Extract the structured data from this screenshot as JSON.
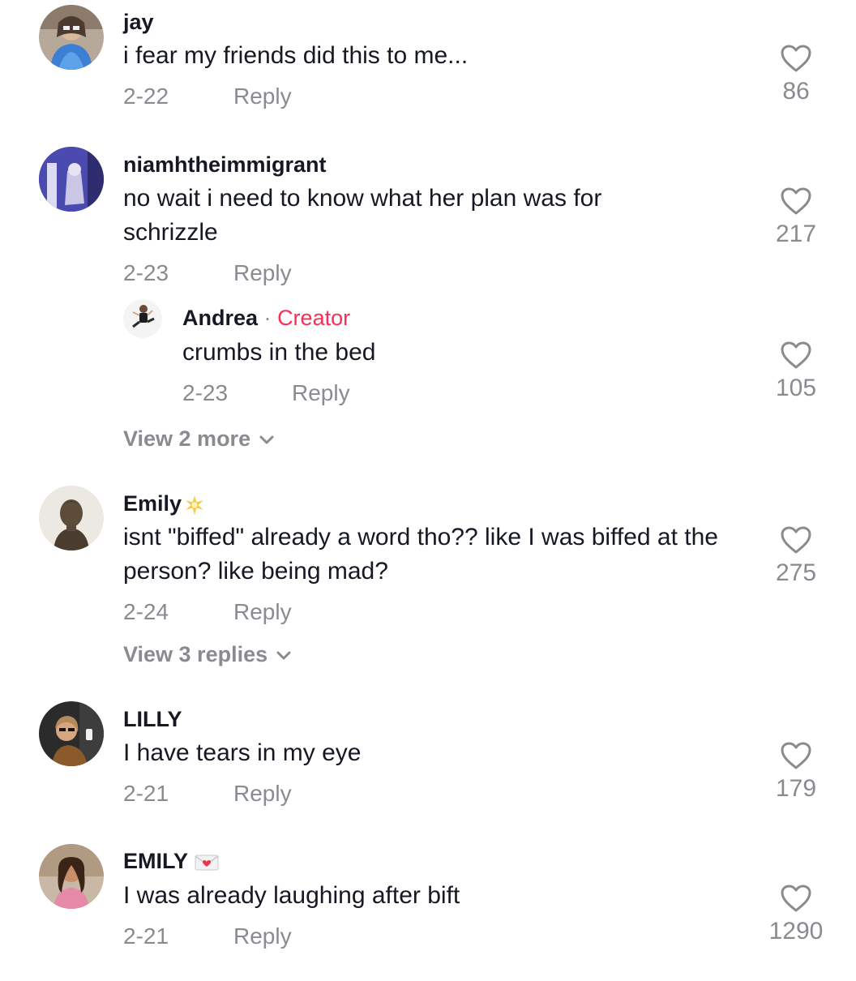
{
  "comments": [
    {
      "username": "jay",
      "text": "i fear my friends did this to me...",
      "date": "2-22",
      "reply": "Reply",
      "likes": "86"
    },
    {
      "username": "niamhtheimmigrant",
      "text": "no wait i need to know what her plan was for schrizzle",
      "date": "2-23",
      "reply": "Reply",
      "likes": "217",
      "replies": [
        {
          "username": "Andrea",
          "separator": "·",
          "badge": "Creator",
          "text": "crumbs in the bed",
          "date": "2-23",
          "reply": "Reply",
          "likes": "105"
        }
      ],
      "view_more": "View 2 more"
    },
    {
      "username": "Emily",
      "username_emoji": "sparkle-star",
      "text": "isnt \"biffed\" already a word tho?? like I was biffed at the person? like being mad?",
      "date": "2-24",
      "reply": "Reply",
      "likes": "275",
      "view_more": "View 3 replies"
    },
    {
      "username": "LILLY",
      "text": "I have tears in my eye",
      "date": "2-21",
      "reply": "Reply",
      "likes": "179"
    },
    {
      "username": "EMILY",
      "username_emoji": "love-letter",
      "text": "I was already laughing after bift",
      "date": "2-21",
      "reply": "Reply",
      "likes": "1290"
    }
  ],
  "colors": {
    "text": "#161823",
    "muted": "#8a8b91",
    "creator": "#fe2c55"
  }
}
